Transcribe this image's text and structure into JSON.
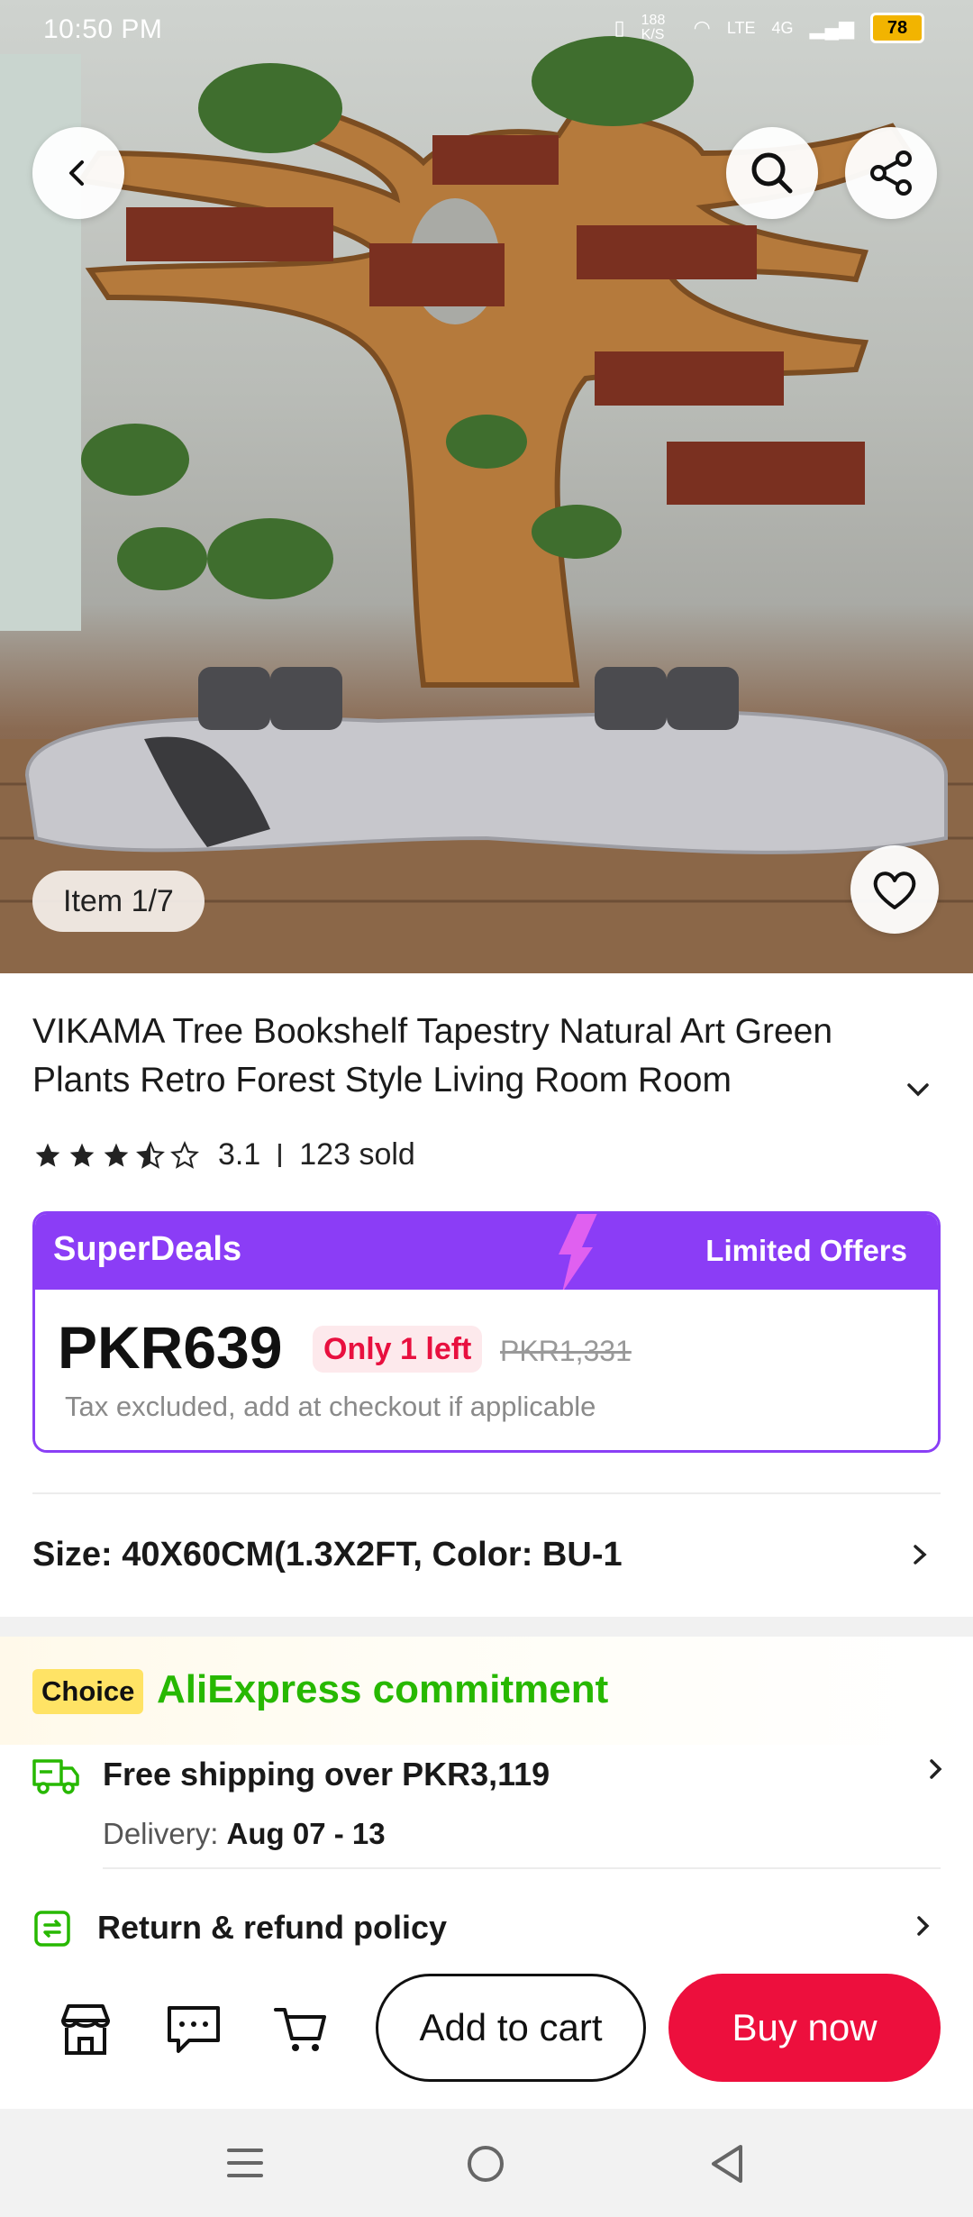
{
  "status_bar": {
    "time": "10:50 PM",
    "net_speed": "188 K/S",
    "network": "LTE",
    "signal": "4G",
    "battery": "78"
  },
  "gallery": {
    "counter": "Item 1/7"
  },
  "product": {
    "title": "VIKAMA Tree Bookshelf Tapestry Natural Art Green Plants Retro Forest Style Living Room Room",
    "rating": "3.1",
    "rating_value": 3.1,
    "sold": "123 sold"
  },
  "deal": {
    "brand": "SuperDeals",
    "tag": "Limited Offers",
    "price": "PKR639",
    "stock": "Only 1 left",
    "original_price": "PKR1,331",
    "tax_note": "Tax excluded, add at checkout if applicable"
  },
  "variant": {
    "label": "Size: 40X60CM(1.3X2FT, Color: BU-1"
  },
  "commitment": {
    "badge": "Choice",
    "title": "AliExpress commitment",
    "shipping_title": "Free shipping over PKR3,119",
    "delivery_label": "Delivery:",
    "delivery_dates": "Aug 07 - 13",
    "return_title": "Return & refund policy"
  },
  "actions": {
    "add_to_cart": "Add to cart",
    "buy_now": "Buy now"
  },
  "colors": {
    "superdeals_purple": "#8b3df6",
    "buy_red": "#ed0f3d",
    "choice_green": "#27b800",
    "choice_yellow": "#ffe365"
  },
  "icons": [
    "back-icon",
    "search-icon",
    "share-icon",
    "heart-icon",
    "truck-icon",
    "return-icon",
    "store-icon",
    "chat-icon",
    "cart-icon",
    "menu-icon",
    "home-icon",
    "back-triangle-icon"
  ]
}
